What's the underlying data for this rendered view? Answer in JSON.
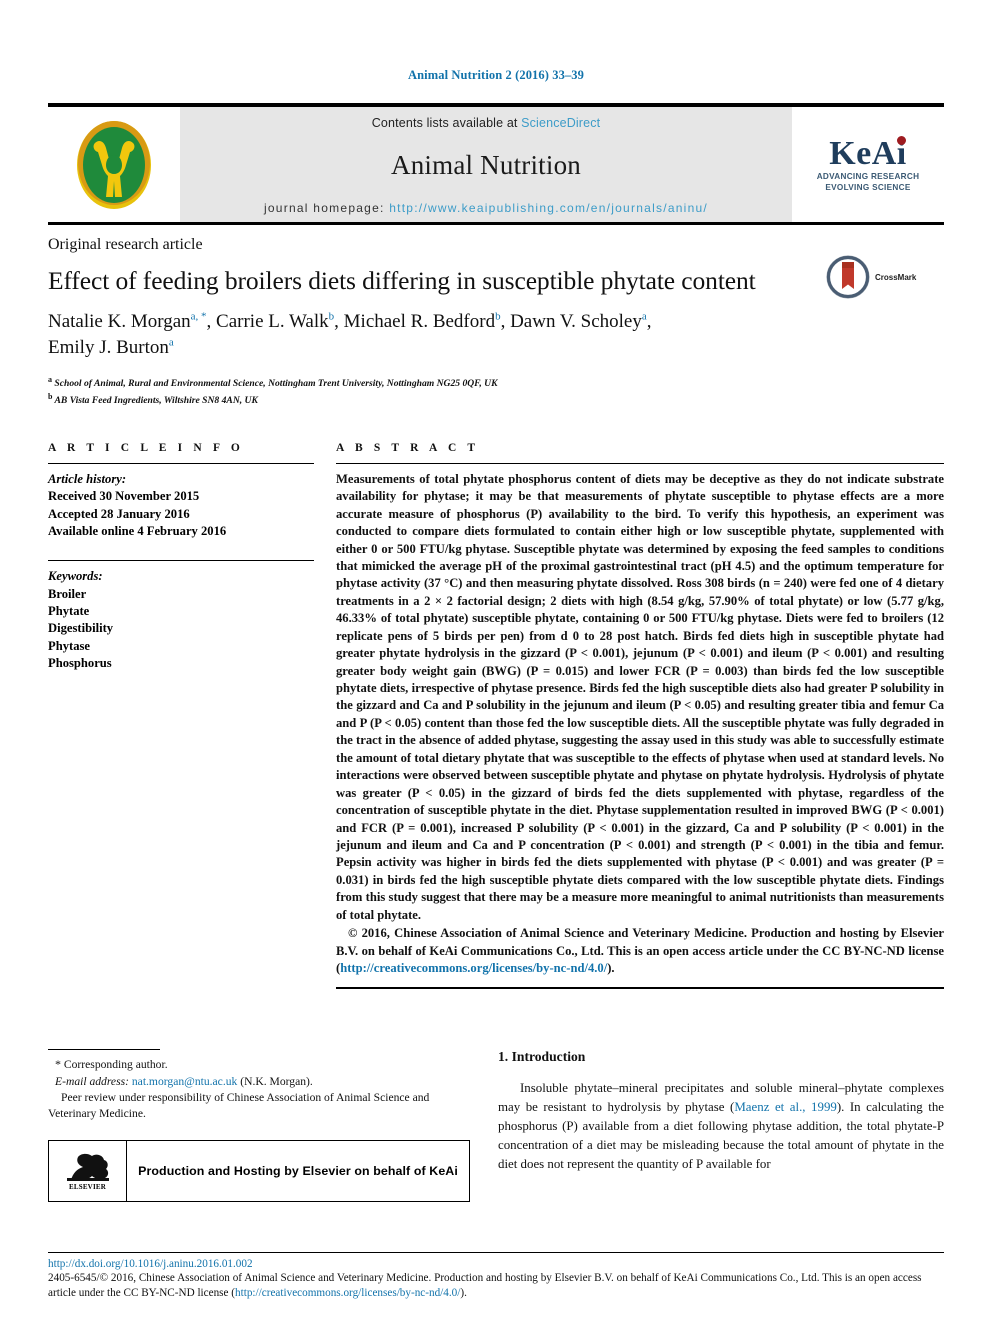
{
  "running_head": "Animal Nutrition 2 (2016) 33–39",
  "masthead": {
    "contents_prefix": "Contents lists available at ",
    "sciencedirect": "ScienceDirect",
    "journal_title": "Animal Nutrition",
    "homepage_label": "journal homepage: ",
    "homepage_url": "http://www.keaipublishing.com/en/journals/aninu/",
    "keai_text": "KeAi",
    "keai_tagline_1": "ADVANCING RESEARCH",
    "keai_tagline_2": "EVOLVING SCIENCE",
    "emblem_colors": {
      "ring_outer": "#d89a14",
      "ring_inner": "#1f8a3b",
      "figure": "#f2c70d"
    },
    "band_color": "#e6e6e6",
    "link_color": "#3d9cc8"
  },
  "article": {
    "kicker": "Original research article",
    "title": "Effect of feeding broilers diets differing in susceptible phytate content",
    "authors_line_1_parts": [
      {
        "name": "Natalie K. Morgan",
        "sup": "a, *"
      },
      {
        "name": "Carrie L. Walk",
        "sup": "b"
      },
      {
        "name": "Michael R. Bedford",
        "sup": "b"
      },
      {
        "name": "Dawn V. Scholey",
        "sup": "a"
      }
    ],
    "authors_line_2_parts": [
      {
        "name": "Emily J. Burton",
        "sup": "a"
      }
    ],
    "affiliations": [
      {
        "marker": "a",
        "text": "School of Animal, Rural and Environmental Science, Nottingham Trent University, Nottingham NG25 0QF, UK"
      },
      {
        "marker": "b",
        "text": "AB Vista Feed Ingredients, Wiltshire SN8 4AN, UK"
      }
    ],
    "crossmark_label": "CrossMark"
  },
  "article_info": {
    "heading": "A R T I C L E  I N F O",
    "history_label": "Article history:",
    "history": [
      "Received 30 November 2015",
      "Accepted 28 January 2016",
      "Available online 4 February 2016"
    ],
    "keywords_label": "Keywords:",
    "keywords": [
      "Broiler",
      "Phytate",
      "Digestibility",
      "Phytase",
      "Phosphorus"
    ]
  },
  "abstract": {
    "heading": "A B S T R A C T",
    "body": "Measurements of total phytate phosphorus content of diets may be deceptive as they do not indicate substrate availability for phytase; it may be that measurements of phytate susceptible to phytase effects are a more accurate measure of phosphorus (P) availability to the bird. To verify this hypothesis, an experiment was conducted to compare diets formulated to contain either high or low susceptible phytate, supplemented with either 0 or 500 FTU/kg phytase. Susceptible phytate was determined by exposing the feed samples to conditions that mimicked the average pH of the proximal gastrointestinal tract (pH 4.5) and the optimum temperature for phytase activity (37 °C) and then measuring phytate dissolved. Ross 308 birds (n = 240) were fed one of 4 dietary treatments in a 2 × 2 factorial design; 2 diets with high (8.54 g/kg, 57.90% of total phytate) or low (5.77 g/kg, 46.33% of total phytate) susceptible phytate, containing 0 or 500 FTU/kg phytase. Diets were fed to broilers (12 replicate pens of 5 birds per pen) from d 0 to 28 post hatch. Birds fed diets high in susceptible phytate had greater phytate hydrolysis in the gizzard (P < 0.001), jejunum (P < 0.001) and ileum (P < 0.001) and resulting greater body weight gain (BWG) (P = 0.015) and lower FCR (P = 0.003) than birds fed the low susceptible phytate diets, irrespective of phytase presence. Birds fed the high susceptible diets also had greater P solubility in the gizzard and Ca and P solubility in the jejunum and ileum (P < 0.05) and resulting greater tibia and femur Ca and P (P < 0.05) content than those fed the low susceptible diets. All the susceptible phytate was fully degraded in the tract in the absence of added phytase, suggesting the assay used in this study was able to successfully estimate the amount of total dietary phytate that was susceptible to the effects of phytase when used at standard levels. No interactions were observed between susceptible phytate and phytase on phytate hydrolysis. Hydrolysis of phytate was greater (P < 0.05) in the gizzard of birds fed the diets supplemented with phytase, regardless of the concentration of susceptible phytate in the diet. Phytase supplementation resulted in improved BWG (P < 0.001) and FCR (P = 0.001), increased P solubility (P < 0.001) in the gizzard, Ca and P solubility (P < 0.001) in the jejunum and ileum and Ca and P concentration (P < 0.001) and strength (P < 0.001) in the tibia and femur. Pepsin activity was higher in birds fed the diets supplemented with phytase (P < 0.001) and was greater (P = 0.031) in birds fed the high susceptible phytate diets compared with the low susceptible phytate diets. Findings from this study suggest that there may be a measure more meaningful to animal nutritionists than measurements of total phytate.",
    "copyright_text": "© 2016, Chinese Association of Animal Science and Veterinary Medicine. Production and hosting by Elsevier B.V. on behalf of KeAi Communications Co., Ltd. This is an open access article under the CC BY-NC-ND license (",
    "license_url": "http://creativecommons.org/licenses/by-nc-nd/4.0/",
    "copyright_tail": ")."
  },
  "footnotes": {
    "corresponding_marker": "*",
    "corresponding_label": "Corresponding author.",
    "email_label": "E-mail address:",
    "email": "nat.morgan@ntu.ac.uk",
    "email_attrib": "(N.K. Morgan).",
    "peer_review": "Peer review under responsibility of Chinese Association of Animal Science and Veterinary Medicine."
  },
  "elsevier_box": {
    "logo_word": "ELSEVIER",
    "text": "Production and Hosting by Elsevier on behalf of KeAi"
  },
  "introduction": {
    "heading": "1. Introduction",
    "paragraph_before_cite": "Insoluble phytate–mineral precipitates and soluble mineral–phytate complexes may be resistant to hydrolysis by phytase (",
    "citation": "Maenz et al., 1999",
    "paragraph_after_cite": "). In calculating the phosphorus (P) available from a diet following phytase addition, the total phytate-P concentration of a diet may be misleading because the total amount of phytate in the diet does not represent the quantity of P available for"
  },
  "footer": {
    "doi": "http://dx.doi.org/10.1016/j.aninu.2016.01.002",
    "issn_copyright": "2405-6545/© 2016, Chinese Association of Animal Science and Veterinary Medicine. Production and hosting by Elsevier B.V. on behalf of KeAi Communications Co., Ltd. This is an open access article under the CC BY-NC-ND license (",
    "license_url": "http://creativecommons.org/licenses/by-nc-nd/4.0/",
    "issn_tail": ")."
  }
}
